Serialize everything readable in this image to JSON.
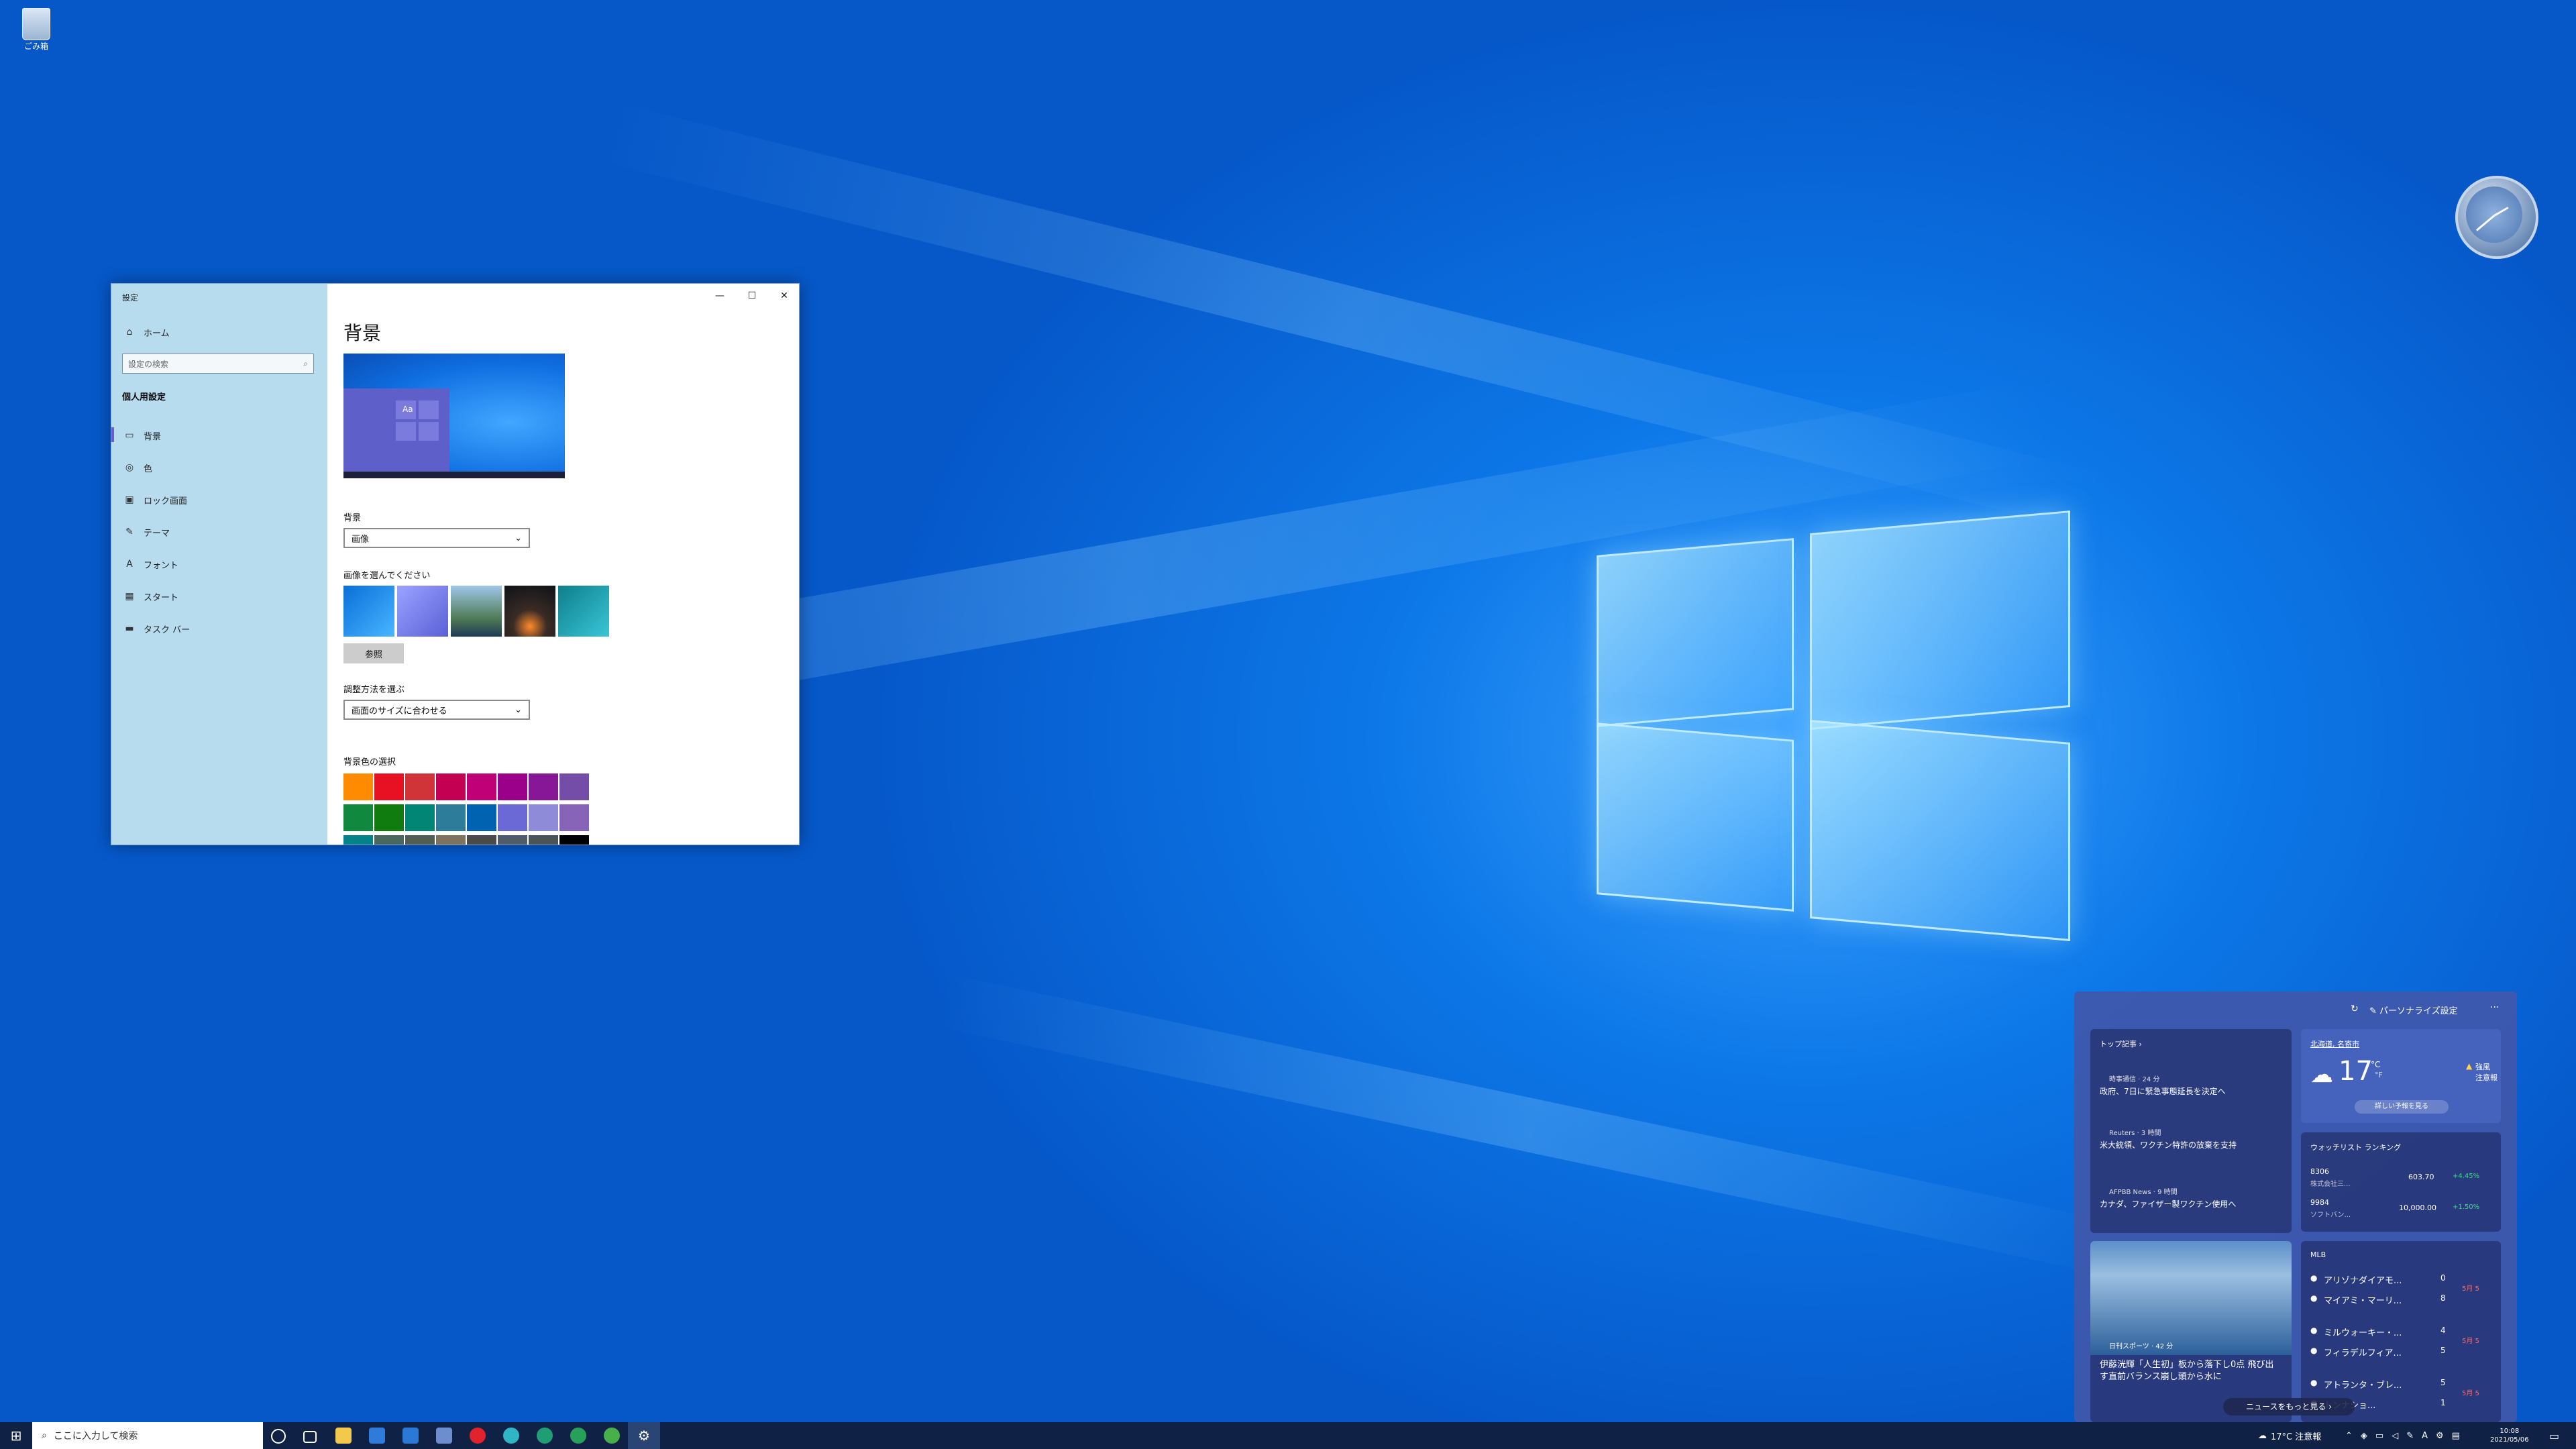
{
  "desktop": {
    "recycle_bin_label": "ごみ箱"
  },
  "settings": {
    "app_title": "設定",
    "window_buttons": {
      "minimize": "—",
      "maximize": "☐",
      "close": "✕"
    },
    "home": "ホーム",
    "search_placeholder": "設定の検索",
    "section": "個人用設定",
    "nav": [
      "背景",
      "色",
      "ロック画面",
      "テーマ",
      "フォント",
      "スタート",
      "タスク バー"
    ],
    "page_title": "背景",
    "bg_label": "背景",
    "bg_value": "画像",
    "choose_label": "画像を選んでください",
    "browse": "参照",
    "fit_label": "調整方法を選ぶ",
    "fit_value": "画面のサイズに合わせる",
    "color_label": "背景色の選択",
    "preview_aa": "Aa",
    "swatches_row1": [
      "#ff8c00",
      "#e81123",
      "#d13438",
      "#c30052",
      "#bf0077",
      "#9a0089",
      "#881798",
      "#744da9"
    ],
    "swatches_row2": [
      "#10893e",
      "#107c10",
      "#018574",
      "#2d7d9a",
      "#0063b1",
      "#6b69d6",
      "#8e8cd8",
      "#8764b8"
    ],
    "swatches_row3": [
      "#038387",
      "#486860",
      "#525e54",
      "#7e735f",
      "#4c4a48",
      "#515c6b",
      "#4a5459",
      "#000000"
    ]
  },
  "news": {
    "personalize": "パーソナライズ設定",
    "top_stories": "トップ記事 ›",
    "stories": [
      {
        "source": "時事通信 · 24 分",
        "headline": "政府、7日に緊急事態延長を決定へ"
      },
      {
        "source": "Reuters · 3 時間",
        "headline": "米大統領、ワクチン特許の放棄を支持"
      },
      {
        "source": "AFPBB News · 9 時間",
        "headline": "カナダ、ファイザー製ワクチン使用へ"
      }
    ],
    "weather": {
      "location": "北海道, 名寄市",
      "temp": "17",
      "unit": "°C",
      "unit_alt": "°F",
      "alert1": "強風",
      "alert2": "注意報",
      "forecast": "詳しい予報を見る"
    },
    "watchlist": {
      "title": "ウォッチリスト ランキング",
      "rows": [
        {
          "code": "8306",
          "name": "株式会社三...",
          "price": "603.70",
          "change": "+4.45%"
        },
        {
          "code": "9984",
          "name": "ソフトバン...",
          "price": "10,000.00",
          "change": "+1.50%"
        }
      ]
    },
    "photo_story": {
      "source": "日刊スポーツ · 42 分",
      "headline": "伊藤洸輝「人生初」板から落下し0点 飛び出す直前バランス崩し頭から水に"
    },
    "mlb": {
      "title": "MLB",
      "games": [
        {
          "team1": "アリゾナダイアモ...",
          "score1": "0",
          "team2": "マイアミ・マーリ...",
          "score2": "8",
          "status": "5月 5"
        },
        {
          "team1": "ミルウォーキー・...",
          "score1": "4",
          "team2": "フィラデルフィア...",
          "score2": "5",
          "status": "5月 5"
        },
        {
          "team1": "アトランタ・ブレ...",
          "score1": "5",
          "team2": "トンナショ...",
          "score2": "1",
          "status": "5月 5"
        }
      ]
    },
    "more": "ニュースをもっと見る ›"
  },
  "taskbar": {
    "search_placeholder": "ここに入力して検索",
    "weather": "17°C 注意報",
    "time": "10:08",
    "date": "2021/05/06"
  }
}
